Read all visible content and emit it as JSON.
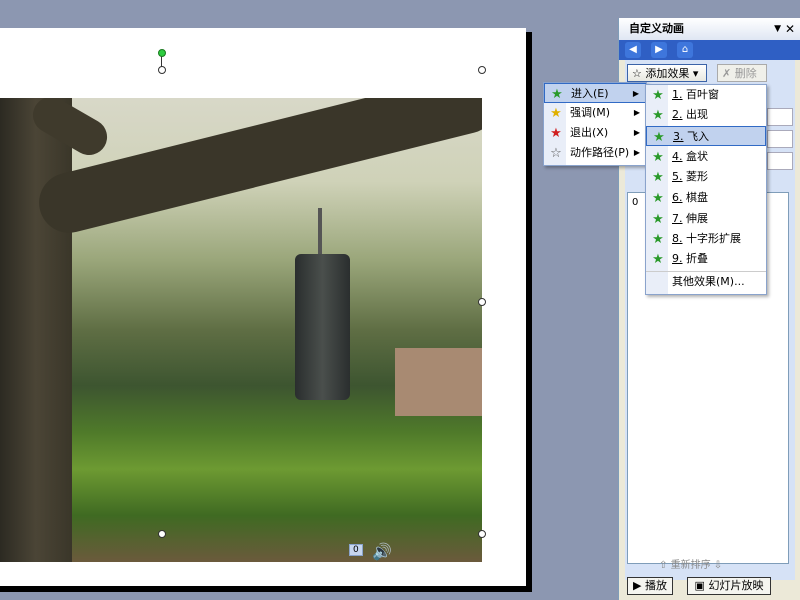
{
  "task_pane": {
    "title": "自定义动画",
    "add_effect_label": "添加效果",
    "remove_label": "删除",
    "list_first_number": "0",
    "reorder_label": "重新排序",
    "play_label": "播放",
    "slideshow_label": "幻灯片放映"
  },
  "slide": {
    "sound_number": "0"
  },
  "menu_main": {
    "items": [
      {
        "label": "进入(E)",
        "icon": "star-green-icon"
      },
      {
        "label": "强调(M)",
        "icon": "star-yellow-icon"
      },
      {
        "label": "退出(X)",
        "icon": "star-red-icon"
      },
      {
        "label": "动作路径(P)",
        "icon": "star-outline-icon"
      }
    ]
  },
  "menu_entrance": {
    "items": [
      {
        "number": "1.",
        "label": "百叶窗"
      },
      {
        "number": "2.",
        "label": "出现"
      },
      {
        "number": "3.",
        "label": "飞入"
      },
      {
        "number": "4.",
        "label": "盒状"
      },
      {
        "number": "5.",
        "label": "菱形"
      },
      {
        "number": "6.",
        "label": "棋盘"
      },
      {
        "number": "7.",
        "label": "伸展"
      },
      {
        "number": "8.",
        "label": "十字形扩展"
      },
      {
        "number": "9.",
        "label": "折叠"
      }
    ],
    "more_label": "其他效果(M)..."
  },
  "colors": {
    "accent": "#316ac5",
    "nav_bar": "#2f5fc4",
    "workspace": "#8c97b1"
  }
}
